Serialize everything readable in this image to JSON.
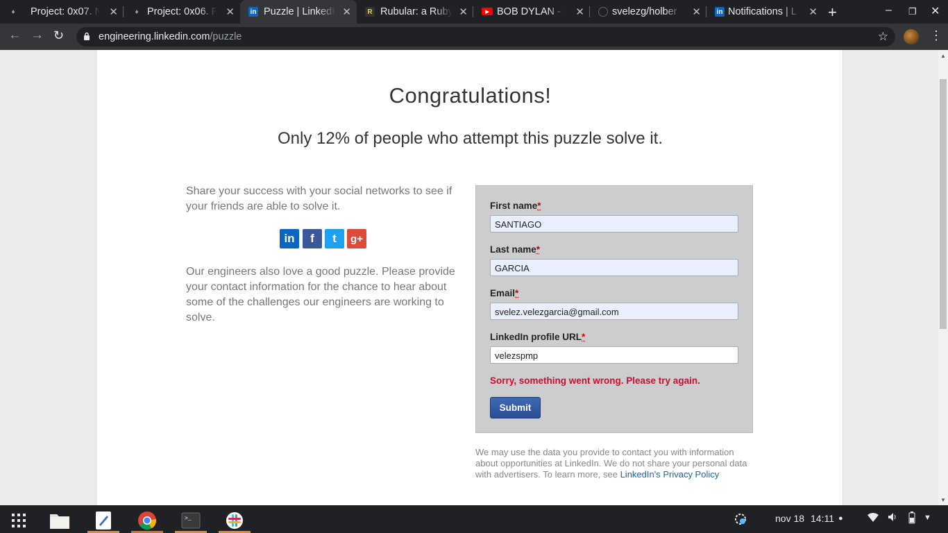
{
  "browser": {
    "tabs": [
      {
        "title": "Project: 0x07. N",
        "favicon": "holberton-icon",
        "active": false
      },
      {
        "title": "Project: 0x06. R",
        "favicon": "holberton-icon",
        "active": false
      },
      {
        "title": "Puzzle | LinkedIn",
        "favicon": "linkedin-icon",
        "active": true
      },
      {
        "title": "Rubular: a Ruby",
        "favicon": "rubular-icon",
        "active": false
      },
      {
        "title": "BOB DYLAN - M",
        "favicon": "youtube-icon",
        "active": false
      },
      {
        "title": "svelezg/holber",
        "favicon": "github-icon",
        "active": false
      },
      {
        "title": "Notifications | L",
        "favicon": "linkedin-icon",
        "active": false
      }
    ],
    "url_host": "engineering.linkedin.com",
    "url_path": "/puzzle"
  },
  "page": {
    "title": "Congratulations!",
    "subtitle": "Only 12% of people who attempt this puzzle solve it.",
    "share_text": "Share your success with your social networks to see if your friends are able to solve it.",
    "social_linkedin": "in",
    "social_facebook": "f",
    "social_twitter": "t",
    "social_gplus": "g+",
    "engineers_text": "Our engineers also love a good puzzle. Please provide your contact information for the chance to hear about some of the challenges our engineers are working to solve."
  },
  "form": {
    "first_name_label": "First name",
    "first_name_value": "SANTIAGO",
    "last_name_label": "Last name",
    "last_name_value": "GARCIA",
    "email_label": "Email",
    "email_value": "svelez.velezgarcia@gmail.com",
    "profile_label": "LinkedIn profile URL",
    "profile_value": "velezspmp",
    "required_mark": "*",
    "error": "Sorry, something went wrong. Please try again.",
    "submit_label": "Submit"
  },
  "disclaimer": {
    "text": "We may use the data you provide to contact you with information about opportunities at LinkedIn. We do not share your personal data with advertisers. To learn more, see ",
    "link": "LinkedIn's Privacy Policy"
  },
  "shelf": {
    "date": "nov 18",
    "time": "14:11"
  }
}
